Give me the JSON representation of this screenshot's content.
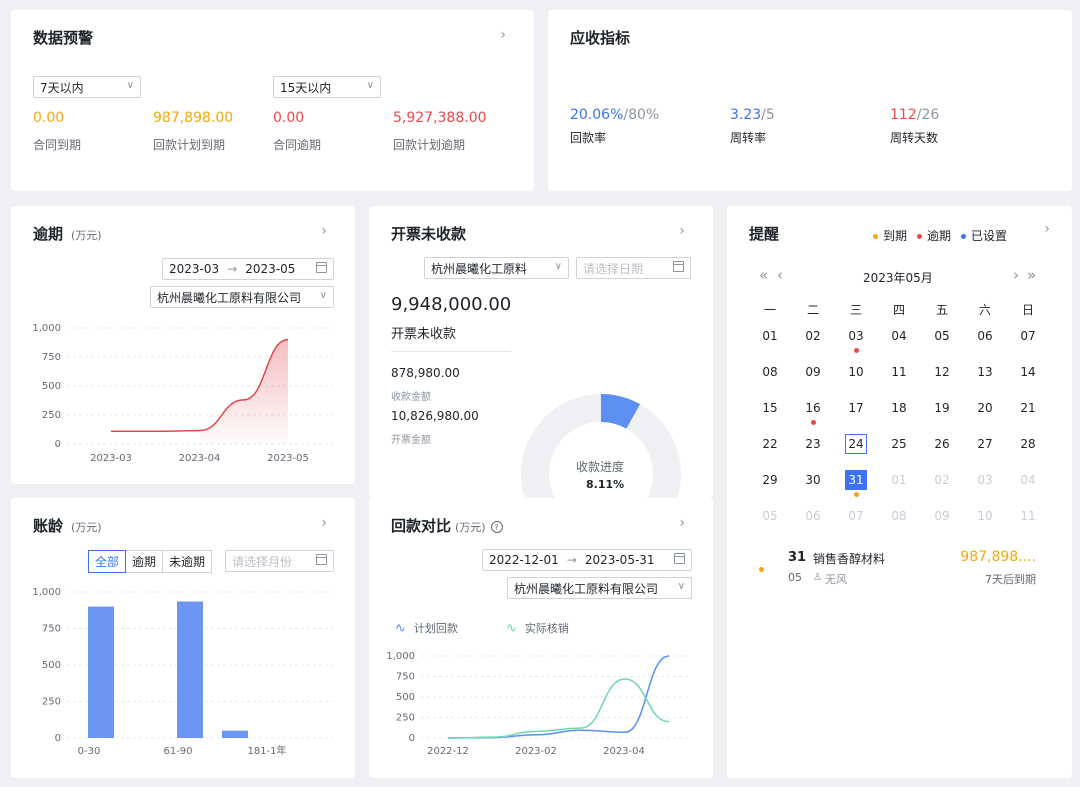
{
  "warning": {
    "title": "数据预警",
    "select1": "7天以内",
    "select2": "15天以内",
    "stats": [
      {
        "value": "0.00",
        "label": "合同到期",
        "color": "#f2a90e"
      },
      {
        "value": "987,898.00",
        "label": "回款计划到期",
        "color": "#f2a90e"
      },
      {
        "value": "0.00",
        "label": "合同逾期",
        "color": "#f04848"
      },
      {
        "value": "5,927,388.00",
        "label": "回款计划逾期",
        "color": "#f04848"
      }
    ]
  },
  "receivable": {
    "title": "应收指标",
    "metrics": [
      {
        "value": "20.06%",
        "target": "/80%",
        "label": "回款率",
        "color": "#3a72f0"
      },
      {
        "value": "3.23",
        "target": "/5",
        "label": "周转率",
        "color": "#3a72f0"
      },
      {
        "value": "112",
        "target": "/26",
        "label": "周转天数",
        "color": "#f04848"
      }
    ]
  },
  "overdue": {
    "title": "逾期",
    "unit": "(万元)",
    "date_start": "2023-03",
    "date_sep": "→",
    "date_end": "2023-05",
    "company": "杭州晨曦化工原料有限公司",
    "chart_data": {
      "type": "area",
      "x": [
        "2023-03",
        "2023-03-15",
        "2023-04",
        "2023-04-15",
        "2023-05"
      ],
      "values": [
        110,
        110,
        115,
        380,
        900
      ],
      "xticks": [
        "2023-03",
        "2023-04",
        "2023-05"
      ],
      "yticks": [
        "0",
        "250",
        "500",
        "750",
        "1,000"
      ],
      "ylim": [
        0,
        1000
      ],
      "color": "#e0474c"
    }
  },
  "invoice": {
    "title": "开票未收款",
    "company": "杭州晨曦化工原料",
    "date_placeholder": "请选择日期",
    "amount": "9,948,000.00",
    "amount_label": "开票未收款",
    "received": "878,980.00",
    "received_label": "收款金额",
    "invoiced": "10,826,980.00",
    "invoiced_label": "开票金额",
    "progress_label": "收款进度",
    "progress_value": "8.11%",
    "progress_fraction": 0.0811
  },
  "reminder": {
    "title": "提醒",
    "legend": [
      {
        "label": "到期",
        "color": "#f2a90e"
      },
      {
        "label": "逾期",
        "color": "#f04848"
      },
      {
        "label": "已设置",
        "color": "#3a72f0"
      }
    ],
    "month": "2023年05月",
    "nav_prev_year": "«",
    "nav_prev": "‹",
    "nav_next": "›",
    "nav_next_year": "»",
    "weekdays": [
      "一",
      "二",
      "三",
      "四",
      "五",
      "六",
      "日"
    ],
    "days": [
      "01",
      "02",
      "03",
      "04",
      "05",
      "06",
      "07",
      "08",
      "09",
      "10",
      "11",
      "12",
      "13",
      "14",
      "15",
      "16",
      "17",
      "18",
      "19",
      "20",
      "21",
      "22",
      "23",
      "24",
      "25",
      "26",
      "27",
      "28",
      "29",
      "30",
      "31",
      "01",
      "02",
      "03",
      "04",
      "05",
      "06",
      "07",
      "08",
      "09",
      "10",
      "11"
    ],
    "item": {
      "day": "31",
      "month": "05",
      "name": "销售香醇材料",
      "amount": "987,898....",
      "person": "无风",
      "due": "7天后到期"
    }
  },
  "aging": {
    "title": "账龄",
    "unit": "(万元)",
    "filters": [
      "全部",
      "逾期",
      "未逾期"
    ],
    "month_placeholder": "请选择月份",
    "chart_data": {
      "type": "bar",
      "categories": [
        "0-30",
        "31-60",
        "61-90",
        "91-180",
        "181-1年",
        "1年以上"
      ],
      "xticks": [
        "0-30",
        "61-90",
        "181-1年"
      ],
      "values": [
        900,
        0,
        935,
        50,
        0,
        0
      ],
      "yticks": [
        "0",
        "250",
        "500",
        "750",
        "1,000"
      ],
      "ylim": [
        0,
        1000
      ],
      "color": "#6b95f0"
    }
  },
  "comparison": {
    "title": "回款对比",
    "unit": "(万元)",
    "date_start": "2022-12-01",
    "date_sep": "→",
    "date_end": "2023-05-31",
    "company": "杭州晨曦化工原料有限公司",
    "chart_data": {
      "type": "line",
      "x": [
        "2022-12",
        "2023-01",
        "2023-02",
        "2023-03",
        "2023-04",
        "2023-05"
      ],
      "xticks": [
        "2022-12",
        "2023-02",
        "2023-04"
      ],
      "series": [
        {
          "name": "计划回款",
          "color": "#5b8ff0",
          "values": [
            0,
            5,
            40,
            95,
            70,
            1000
          ]
        },
        {
          "name": "实际核销",
          "color": "#6fd6b0",
          "values": [
            0,
            10,
            80,
            120,
            720,
            200
          ]
        }
      ],
      "yticks": [
        "0",
        "250",
        "500",
        "750",
        "1,000"
      ],
      "ylim": [
        0,
        1000
      ]
    }
  }
}
